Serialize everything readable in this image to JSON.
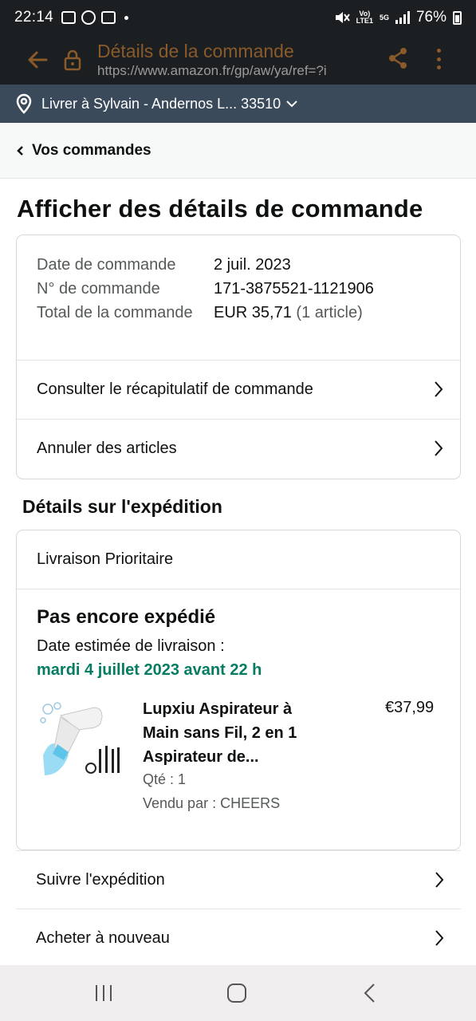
{
  "status_bar": {
    "time": "22:14",
    "network_top": "Vo)",
    "network_bottom": "LTE1",
    "gen_label": "5G",
    "battery": "76%"
  },
  "browser": {
    "title": "Détails de la commande",
    "url": "https://www.amazon.fr/gp/aw/ya/ref=?i",
    "accent_color": "#8a5a2b"
  },
  "deliver_to": {
    "label": "Livrer à Sylvain - Andernos L... 33510"
  },
  "breadcrumb": {
    "label": "Vos commandes"
  },
  "page_title": "Afficher des détails de commande",
  "order_summary": {
    "rows": [
      {
        "label": "Date de commande",
        "value": "2 juil. 2023"
      },
      {
        "label": "N° de commande",
        "value": "171-3875521-1121906"
      },
      {
        "label": "Total de la commande",
        "value": "EUR 35,71",
        "extra": "(1 article)"
      }
    ],
    "links": [
      {
        "label": "Consulter le récapitulatif de commande"
      },
      {
        "label": "Annuler des articles"
      }
    ]
  },
  "shipment": {
    "section_title": "Détails sur l'expédition",
    "delivery_type": "Livraison Prioritaire",
    "status": "Pas encore expédié",
    "estimated_label": "Date estimée de livraison :",
    "estimated_date": "mardi 4 juillet 2023 avant 22 h",
    "estimated_color": "#067d62",
    "item": {
      "title": "Lupxiu Aspirateur à Main sans Fil, 2 en 1 Aspirateur de...",
      "price": "€37,99",
      "quantity": "Qté : 1",
      "seller": "Vendu par : CHEERS"
    }
  },
  "actions": [
    {
      "label": "Suivre l'expédition"
    },
    {
      "label": "Acheter à nouveau"
    }
  ]
}
